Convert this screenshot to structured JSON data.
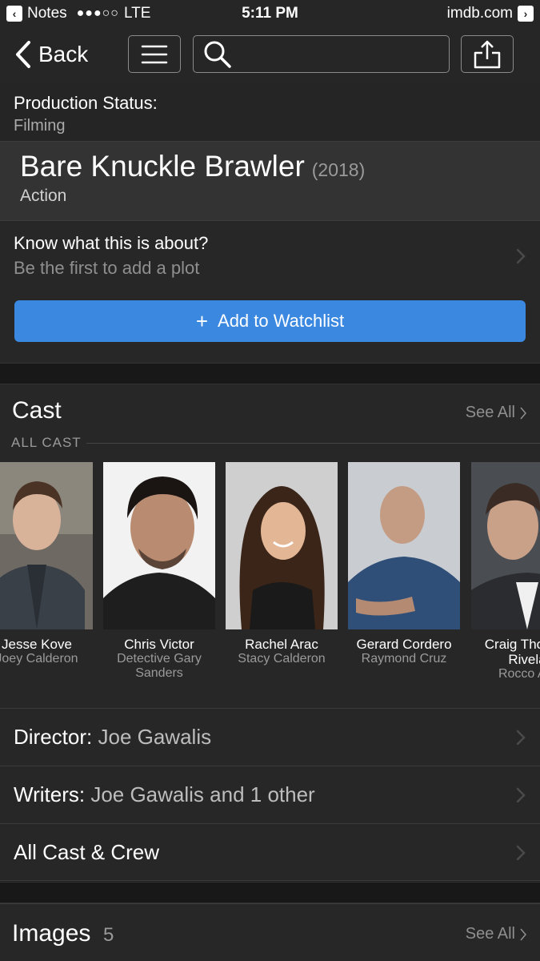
{
  "status_bar": {
    "back_app": "Notes",
    "signal": "●●●○○",
    "network": "LTE",
    "time": "5:11 PM",
    "domain": "imdb.com"
  },
  "nav": {
    "back_label": "Back",
    "icons": [
      "chevron-left-icon",
      "menu-icon",
      "search-icon",
      "share-icon"
    ]
  },
  "production": {
    "label": "Production Status:",
    "value": "Filming"
  },
  "movie": {
    "title": "Bare Knuckle Brawler",
    "year": "(2018)",
    "genre": "Action"
  },
  "plot": {
    "question": "Know what this is about?",
    "prompt": "Be the first to add a plot"
  },
  "watchlist": {
    "plus": "+",
    "label": "Add to Watchlist",
    "color": "#3b88e0"
  },
  "cast": {
    "title": "Cast",
    "see_all": "See All",
    "all_cast_label": "ALL CAST",
    "members": [
      {
        "name": "Jesse Kove",
        "role": "Joey Calderon"
      },
      {
        "name": "Chris Victor",
        "role": "Detective Gary Sanders"
      },
      {
        "name": "Rachel Arac",
        "role": "Stacy Calderon"
      },
      {
        "name": "Gerard Cordero",
        "role": "Raymond Cruz"
      },
      {
        "name": "Craig Thomas Rivela",
        "role": "Rocco Alo"
      }
    ]
  },
  "credits": {
    "director_label": "Director:",
    "director": "Joe Gawalis",
    "writers_label": "Writers:",
    "writers": "Joe Gawalis and 1 other",
    "all_cast_crew": "All Cast & Crew"
  },
  "images": {
    "title": "Images",
    "count": "5",
    "see_all": "See All"
  }
}
